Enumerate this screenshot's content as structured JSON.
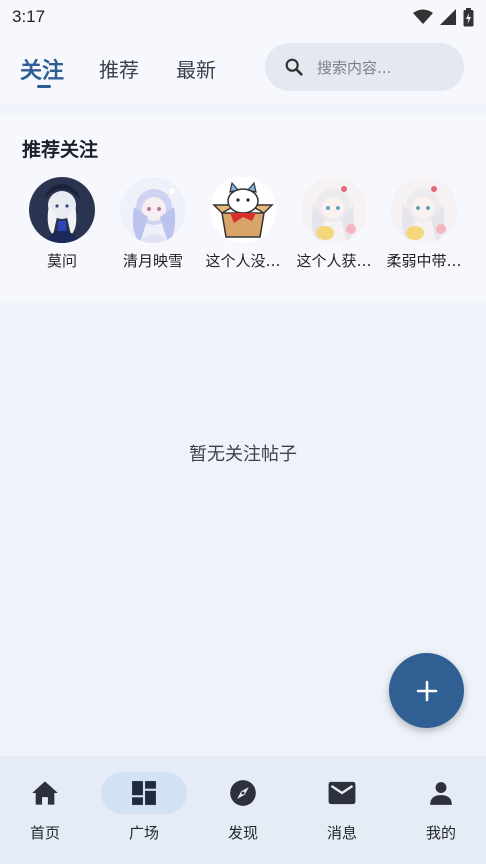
{
  "status_bar": {
    "time": "3:17"
  },
  "header": {
    "tabs": [
      {
        "label": "关注",
        "active": true
      },
      {
        "label": "推荐",
        "active": false
      },
      {
        "label": "最新",
        "active": false
      }
    ],
    "search": {
      "placeholder": "搜索内容..."
    }
  },
  "recommend": {
    "title": "推荐关注",
    "users": [
      {
        "name": "莫问"
      },
      {
        "name": "清月映雪"
      },
      {
        "name": "这个人没…"
      },
      {
        "name": "这个人获…"
      },
      {
        "name": "柔弱中带…"
      }
    ]
  },
  "feed": {
    "empty_text": "暂无关注帖子"
  },
  "fab": {
    "icon": "plus-icon"
  },
  "bottom_nav": {
    "items": [
      {
        "label": "首页",
        "icon": "home-icon",
        "active": false
      },
      {
        "label": "广场",
        "icon": "dashboard-icon",
        "active": true
      },
      {
        "label": "发现",
        "icon": "compass-icon",
        "active": false
      },
      {
        "label": "消息",
        "icon": "mail-icon",
        "active": false
      },
      {
        "label": "我的",
        "icon": "person-icon",
        "active": false
      }
    ]
  },
  "colors": {
    "accent": "#2d5f93",
    "background": "#eef2f9",
    "surface": "#f6f8fd",
    "nav_active_pill": "#d3e1f5"
  }
}
